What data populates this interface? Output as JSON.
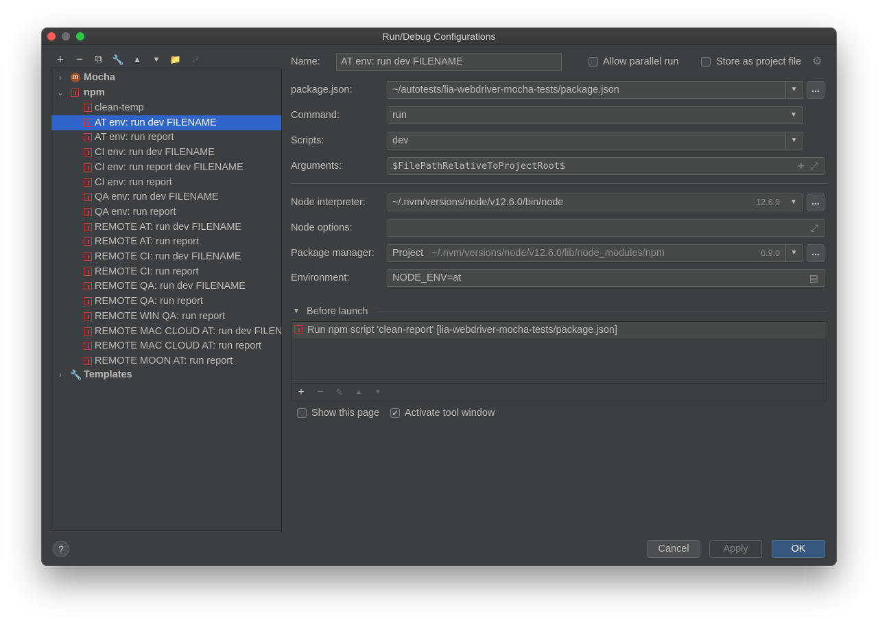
{
  "window": {
    "title": "Run/Debug Configurations"
  },
  "toolbar": {
    "add": "+",
    "remove": "−",
    "copy": "⧉",
    "edit": "🔧",
    "up": "▲",
    "down": "▼",
    "folder": "📁",
    "sort": "↓²"
  },
  "tree": {
    "mocha": "Mocha",
    "npm": "npm",
    "templates": "Templates",
    "mocha_icon_letter": "m",
    "items": [
      "clean-temp",
      "AT env: run dev FILENAME",
      "AT env: run report",
      "CI env: run dev FILENAME",
      "CI env: run report dev FILENAME",
      "CI env: run report",
      "QA env: run dev FILENAME",
      "QA env: run report",
      "REMOTE AT: run dev FILENAME",
      "REMOTE AT: run report",
      "REMOTE CI: run dev FILENAME",
      "REMOTE CI: run report",
      "REMOTE QA: run dev FILENAME",
      "REMOTE QA: run report",
      "REMOTE WIN QA: run report",
      "REMOTE MAC CLOUD AT: run dev FILENAME",
      "REMOTE MAC CLOUD AT: run report",
      "REMOTE MOON AT: run report"
    ],
    "selected_index": 1
  },
  "form": {
    "name_label": "Name:",
    "name_value": "AT env: run dev FILENAME",
    "allow_parallel": "Allow parallel run",
    "store_project": "Store as project file",
    "package_json_label": "package.json:",
    "package_json_value": "~/autotests/lia-webdriver-mocha-tests/package.json",
    "command_label": "Command:",
    "command_value": "run",
    "scripts_label": "Scripts:",
    "scripts_value": "dev",
    "arguments_label": "Arguments:",
    "arguments_value": "$FilePathRelativeToProjectRoot$",
    "node_interp_label": "Node interpreter:",
    "node_interp_value": "~/.nvm/versions/node/v12.6.0/bin/node",
    "node_interp_version": "12.6.0",
    "node_options_label": "Node options:",
    "node_options_value": "",
    "pkg_manager_label": "Package manager:",
    "pkg_manager_value": "Project",
    "pkg_manager_path": "~/.nvm/versions/node/v12.6.0/lib/node_modules/npm",
    "pkg_manager_version": "6.9.0",
    "env_label": "Environment:",
    "env_value": "NODE_ENV=at",
    "ellipsis": "..."
  },
  "before_launch": {
    "title": "Before launch",
    "item": "Run npm script 'clean-report' [lia-webdriver-mocha-tests/package.json]",
    "show_page": "Show this page",
    "activate_tool": "Activate tool window"
  },
  "buttons": {
    "help": "?",
    "cancel": "Cancel",
    "apply": "Apply",
    "ok": "OK"
  }
}
